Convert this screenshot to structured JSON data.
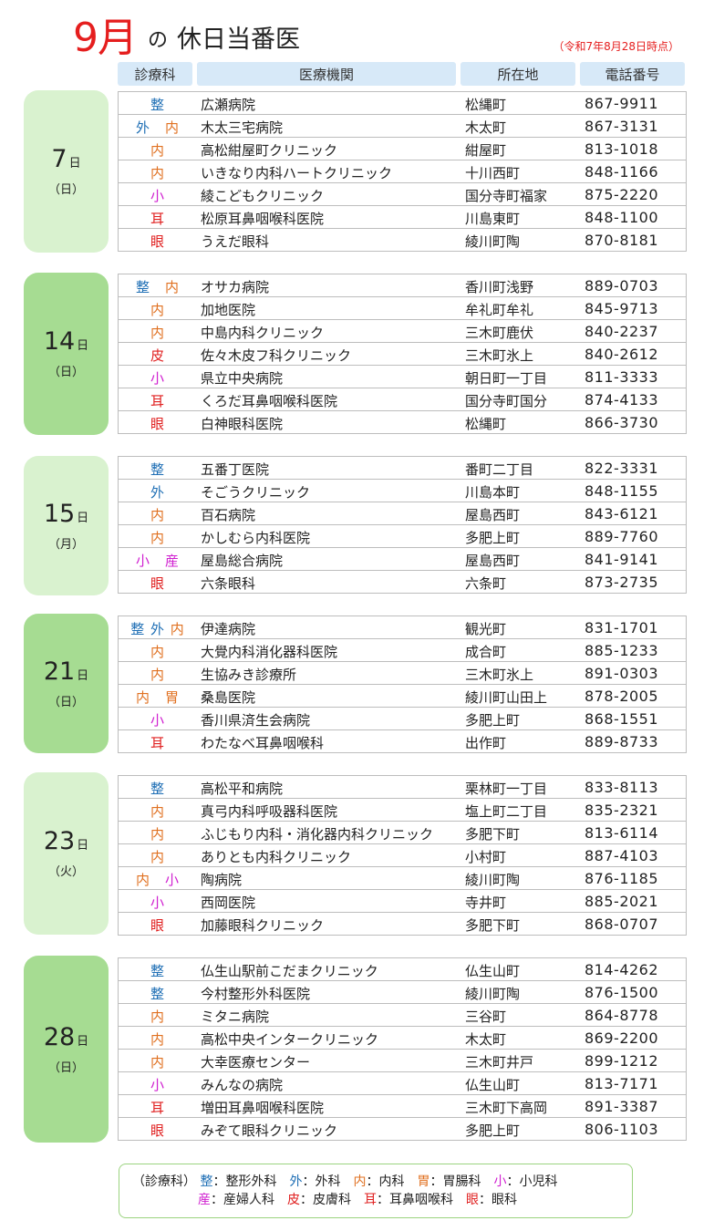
{
  "header": {
    "month": "9月",
    "particle": "の",
    "title_rest": "休日当番医",
    "as_of": "（令和7年8月28日時点）",
    "columns": [
      "診療科",
      "医療機関",
      "所在地",
      "電話番号"
    ]
  },
  "colors": {
    "整": "#1f6fb5",
    "外": "#1f6fb5",
    "内": "#e07020",
    "胃": "#e07020",
    "小": "#d020d0",
    "産": "#d020d0",
    "皮": "#e02020",
    "耳": "#e02020",
    "眼": "#e02020",
    "title_red": "#e51e1e",
    "header_blue": "#d7e9f8",
    "day_light": "#d9f2cf",
    "day_dark": "#a6dc92"
  },
  "days": [
    {
      "num": "7",
      "unit": "日",
      "weekday": "（日）",
      "rows": [
        {
          "dept": "整",
          "name": "広瀬病院",
          "loc": "松縄町",
          "tel": "867-9911"
        },
        {
          "dept": "外　内",
          "name": "木太三宅病院",
          "loc": "木太町",
          "tel": "867-3131"
        },
        {
          "dept": "内",
          "name": "高松紺屋町クリニック",
          "loc": "紺屋町",
          "tel": "813-1018"
        },
        {
          "dept": "内",
          "name": "いきなり内科ハートクリニック",
          "loc": "十川西町",
          "tel": "848-1166"
        },
        {
          "dept": "小",
          "name": "綾こどもクリニック",
          "loc": "国分寺町福家",
          "tel": "875-2220"
        },
        {
          "dept": "耳",
          "name": "松原耳鼻咽喉科医院",
          "loc": "川島東町",
          "tel": "848-1100"
        },
        {
          "dept": "眼",
          "name": "うえだ眼科",
          "loc": "綾川町陶",
          "tel": "870-8181"
        }
      ]
    },
    {
      "num": "14",
      "unit": "日",
      "weekday": "（日）",
      "rows": [
        {
          "dept": "整　内",
          "name": "オサカ病院",
          "loc": "香川町浅野",
          "tel": "889-0703"
        },
        {
          "dept": "内",
          "name": "加地医院",
          "loc": "牟礼町牟礼",
          "tel": "845-9713"
        },
        {
          "dept": "内",
          "name": "中島内科クリニック",
          "loc": "三木町鹿伏",
          "tel": "840-2237"
        },
        {
          "dept": "皮",
          "name": "佐々木皮フ科クリニック",
          "loc": "三木町氷上",
          "tel": "840-2612"
        },
        {
          "dept": "小",
          "name": "県立中央病院",
          "loc": "朝日町一丁目",
          "tel": "811-3333"
        },
        {
          "dept": "耳",
          "name": "くろだ耳鼻咽喉科医院",
          "loc": "国分寺町国分",
          "tel": "874-4133"
        },
        {
          "dept": "眼",
          "name": "白神眼科医院",
          "loc": "松縄町",
          "tel": "866-3730"
        }
      ]
    },
    {
      "num": "15",
      "unit": "日",
      "weekday": "（月）",
      "rows": [
        {
          "dept": "整",
          "name": "五番丁医院",
          "loc": "番町二丁目",
          "tel": "822-3331"
        },
        {
          "dept": "外",
          "name": "そごうクリニック",
          "loc": "川島本町",
          "tel": "848-1155"
        },
        {
          "dept": "内",
          "name": "百石病院",
          "loc": "屋島西町",
          "tel": "843-6121"
        },
        {
          "dept": "内",
          "name": "かしむら内科医院",
          "loc": "多肥上町",
          "tel": "889-7760"
        },
        {
          "dept": "小　産",
          "name": "屋島総合病院",
          "loc": "屋島西町",
          "tel": "841-9141"
        },
        {
          "dept": "眼",
          "name": "六条眼科",
          "loc": "六条町",
          "tel": "873-2735"
        }
      ]
    },
    {
      "num": "21",
      "unit": "日",
      "weekday": "（日）",
      "rows": [
        {
          "dept": "整 外 内",
          "name": "伊達病院",
          "loc": "観光町",
          "tel": "831-1701"
        },
        {
          "dept": "内",
          "name": "大覺内科消化器科医院",
          "loc": "成合町",
          "tel": "885-1233"
        },
        {
          "dept": "内",
          "name": "生協みき診療所",
          "loc": "三木町氷上",
          "tel": "891-0303"
        },
        {
          "dept": "内　胃",
          "name": "桑島医院",
          "loc": "綾川町山田上",
          "tel": "878-2005"
        },
        {
          "dept": "小",
          "name": "香川県済生会病院",
          "loc": "多肥上町",
          "tel": "868-1551"
        },
        {
          "dept": "耳",
          "name": "わたなべ耳鼻咽喉科",
          "loc": "出作町",
          "tel": "889-8733"
        }
      ]
    },
    {
      "num": "23",
      "unit": "日",
      "weekday": "（火）",
      "rows": [
        {
          "dept": "整",
          "name": "高松平和病院",
          "loc": "栗林町一丁目",
          "tel": "833-8113"
        },
        {
          "dept": "内",
          "name": "真弓内科呼吸器科医院",
          "loc": "塩上町二丁目",
          "tel": "835-2321"
        },
        {
          "dept": "内",
          "name": "ふじもり内科・消化器内科クリニック",
          "loc": "多肥下町",
          "tel": "813-6114"
        },
        {
          "dept": "内",
          "name": "ありとも内科クリニック",
          "loc": "小村町",
          "tel": "887-4103"
        },
        {
          "dept": "内　小",
          "name": "陶病院",
          "loc": "綾川町陶",
          "tel": "876-1185"
        },
        {
          "dept": "小",
          "name": "西岡医院",
          "loc": "寺井町",
          "tel": "885-2021"
        },
        {
          "dept": "眼",
          "name": "加藤眼科クリニック",
          "loc": "多肥下町",
          "tel": "868-0707"
        }
      ]
    },
    {
      "num": "28",
      "unit": "日",
      "weekday": "（日）",
      "rows": [
        {
          "dept": "整",
          "name": "仏生山駅前こだまクリニック",
          "loc": "仏生山町",
          "tel": "814-4262"
        },
        {
          "dept": "整",
          "name": "今村整形外科医院",
          "loc": "綾川町陶",
          "tel": "876-1500"
        },
        {
          "dept": "内",
          "name": "ミタニ病院",
          "loc": "三谷町",
          "tel": "864-8778"
        },
        {
          "dept": "内",
          "name": "高松中央インタークリニック",
          "loc": "木太町",
          "tel": "869-2200"
        },
        {
          "dept": "内",
          "name": "大幸医療センター",
          "loc": "三木町井戸",
          "tel": "899-1212"
        },
        {
          "dept": "小",
          "name": "みんなの病院",
          "loc": "仏生山町",
          "tel": "813-7171"
        },
        {
          "dept": "耳",
          "name": "増田耳鼻咽喉科医院",
          "loc": "三木町下高岡",
          "tel": "891-3387"
        },
        {
          "dept": "眼",
          "name": "みぞて眼科クリニック",
          "loc": "多肥上町",
          "tel": "806-1103"
        }
      ]
    }
  ],
  "legend": {
    "label": "（診療科）",
    "line1": [
      {
        "abbr": "整",
        "text": "：整形外科"
      },
      {
        "abbr": "外",
        "text": "：外科"
      },
      {
        "abbr": "内",
        "text": "：内科"
      },
      {
        "abbr": "胃",
        "text": "：胃腸科"
      },
      {
        "abbr": "小",
        "text": "：小児科"
      }
    ],
    "line2": [
      {
        "abbr": "産",
        "text": "：産婦人科"
      },
      {
        "abbr": "皮",
        "text": "：皮膚科"
      },
      {
        "abbr": "耳",
        "text": "：耳鼻咽喉科"
      },
      {
        "abbr": "眼",
        "text": "：眼科"
      }
    ]
  }
}
